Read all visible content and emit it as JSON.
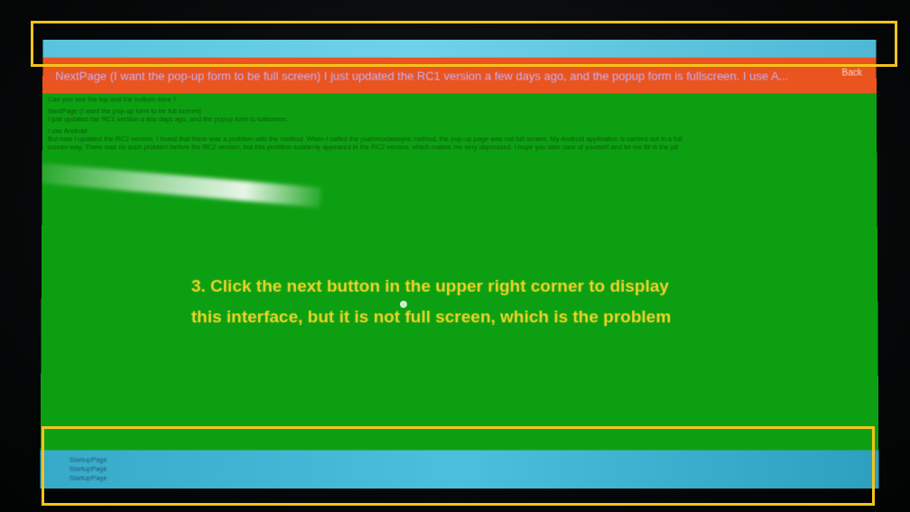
{
  "header": {
    "title": "NextPage (I want the pop-up form to be full screen) I just updated the RC1 version a few days ago, and the popup form is fullscreen.   I use A...",
    "back_label": "Back"
  },
  "content": {
    "question": "Can you see the top and the bottom area ?",
    "para1_line1": "NextPage (I want the pop-up form to be full screen)",
    "para1_line2": "I just updated the RC1 version a few days ago, and the popup form is fullscreen.",
    "para2_line1": "I use Android",
    "para2_line2": "But now I updated the RC2 version, I found that there was a problem with the method. When I called the pushmodalasync method, the pop-up page was not full screen. My Android application is carried out in a full",
    "para2_line3": "screen way. There was no such problem before the RC2 version, but this problem suddenly appeared in the RC2 version, which makes me very depressed. I hope you take care of yourself and let me fill in the pit"
  },
  "annotation": {
    "line1": "3. Click the next button in the upper right corner to display",
    "line2": "this interface, but it is not full screen, which is the problem"
  },
  "bottom": {
    "items": [
      "StartupPage",
      "StartupPage",
      "StartupPage"
    ]
  },
  "colors": {
    "status_bar": "#58c4de",
    "app_bar": "#e9541f",
    "page_background": "#0d9f12",
    "annotation_text": "#f1d427",
    "highlight_box": "#f5c31c"
  }
}
